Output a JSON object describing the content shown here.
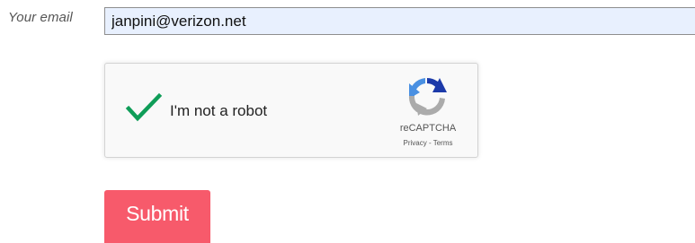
{
  "form": {
    "email_label": "Your email",
    "email_value": "janpini@verizon.net",
    "submit_label": "Submit"
  },
  "recaptcha": {
    "label": "I'm not a robot",
    "brand": "reCAPTCHA",
    "privacy_link": "Privacy",
    "separator": "-",
    "terms_link": "Terms",
    "checked": true,
    "check_icon": "checkmark-icon",
    "logo_icon": "recaptcha-logo-icon"
  },
  "colors": {
    "input_background": "#e8f0fe",
    "check_green": "#0f9d58",
    "submit_background": "#f75a6b"
  }
}
